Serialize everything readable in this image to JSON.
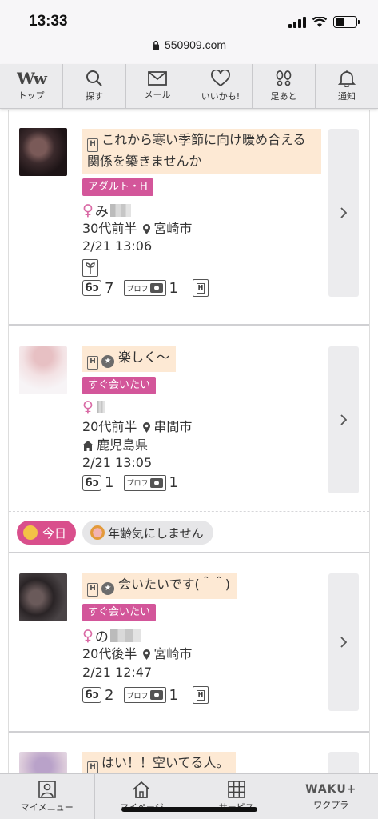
{
  "status": {
    "time": "13:33"
  },
  "browser": {
    "url": "550909.com"
  },
  "topnav": [
    {
      "label": "トップ",
      "icon": "ww-logo-icon"
    },
    {
      "label": "探す",
      "icon": "search-icon"
    },
    {
      "label": "メール",
      "icon": "mail-icon"
    },
    {
      "label": "いいかも!",
      "icon": "heart-icon"
    },
    {
      "label": "足あと",
      "icon": "footprint-icon"
    },
    {
      "label": "通知",
      "icon": "bell-icon"
    }
  ],
  "posts": [
    {
      "message": "これから寒い季節に向け暖め合える関係を築きませんか",
      "tag": "アダルト・H",
      "name": "み",
      "age": "30代前半",
      "location": "宮崎市",
      "hometown": "",
      "datetime": "2/21 13:06",
      "views": "7",
      "photos": "1",
      "prof_label": "プロフ"
    },
    {
      "message": "楽しく〜",
      "tag": "すぐ会いたい",
      "name": "",
      "age": "20代前半",
      "location": "串間市",
      "hometown": "鹿児島県",
      "datetime": "2/21 13:05",
      "views": "1",
      "photos": "1",
      "prof_label": "プロフ"
    },
    {
      "message": "会いたいです(＾＾)",
      "tag": "すぐ会いたい",
      "name": "の",
      "age": "20代後半",
      "location": "宮崎市",
      "hometown": "",
      "datetime": "2/21 12:47",
      "views": "2",
      "photos": "1",
      "prof_label": "プロフ"
    },
    {
      "message": "はい！！空いてる人。"
    }
  ],
  "filters": {
    "today": "今日",
    "age_ok": "年齢気にしません"
  },
  "bottomnav": [
    {
      "label": "マイメニュー",
      "icon": "profile-icon"
    },
    {
      "label": "マイページ",
      "icon": "home-icon"
    },
    {
      "label": "サービス",
      "icon": "grid-icon"
    },
    {
      "label": "ワクプラ",
      "brand": "WAKU+"
    }
  ],
  "colors": {
    "tag_pink": "#d3569a",
    "message_bg": "#fde9d4",
    "female_symbol": "#d96aa5"
  }
}
